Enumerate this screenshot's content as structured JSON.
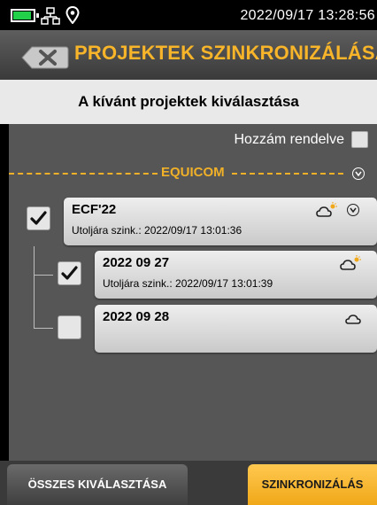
{
  "status_bar": {
    "datetime": "2022/09/17 13:28:56",
    "battery_color": "#22d04a",
    "icons": [
      "battery-icon",
      "network-icon",
      "location-pin-icon"
    ]
  },
  "header": {
    "title": "PROJEKTEK SZINKRONIZÁLÁSA",
    "back_icon": "close-x-icon",
    "title_color": "#f8b52a"
  },
  "subheader": {
    "text": "A kívánt projektek kiválasztása"
  },
  "filter": {
    "assigned_label": "Hozzám rendelve",
    "assigned_checked": false
  },
  "group": {
    "name": "EQUICOM",
    "accent_color": "#f0b028"
  },
  "projects": [
    {
      "name": "ECF'22",
      "sync": "Utoljára szink.: 2022/09/17 13:01:36",
      "checked": true,
      "icon": "cloud-sun-icon",
      "expanded": true
    },
    {
      "name": "2022 09 27",
      "sync": "Utoljára szink.: 2022/09/17 13:01:39",
      "checked": true,
      "icon": "cloud-sun-icon"
    },
    {
      "name": "2022 09 28",
      "sync": "",
      "checked": false,
      "icon": "cloud-icon"
    }
  ],
  "footer": {
    "select_all_label": "ÖSSZES KIVÁLASZTÁSA",
    "sync_label": "SZINKRONIZÁLÁS",
    "sync_color": "#f8b52a"
  }
}
